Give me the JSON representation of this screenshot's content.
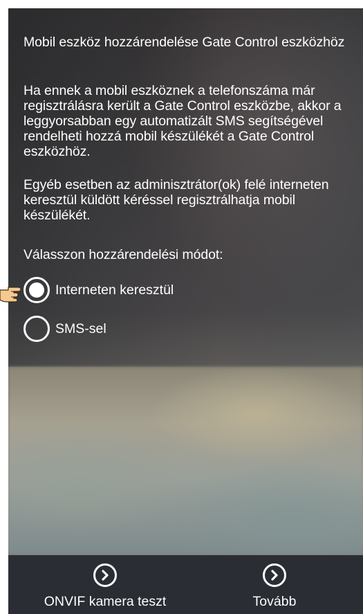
{
  "content": {
    "title": "Mobil eszköz hozzárendelése Gate Control eszközhöz",
    "paragraph1": "Ha ennek a mobil eszköznek a telefonszáma már regisztrálásra került a Gate Control eszközbe, akkor a leggyorsabban egy automatizált SMS segítségével rendelheti hozzá mobil készülékét a Gate Control eszközhöz.",
    "paragraph2": "Egyéb esetben az adminisztrátor(ok) felé interneten keresztül küldött kéréssel regisztrálhatja mobil készülékét.",
    "prompt": "Válasszon hozzárendelési módot:"
  },
  "options": [
    {
      "label": "Interneten keresztül",
      "selected": true
    },
    {
      "label": "SMS-sel",
      "selected": false
    }
  ],
  "bottom_bar": {
    "left_button": {
      "label": "ONVIF kamera teszt",
      "icon": "chevron-right-circle-icon"
    },
    "right_button": {
      "label": "Tovább",
      "icon": "chevron-right-circle-icon"
    }
  },
  "colors": {
    "text": "#ffffff",
    "bottom_bar": "#2a2d33"
  }
}
